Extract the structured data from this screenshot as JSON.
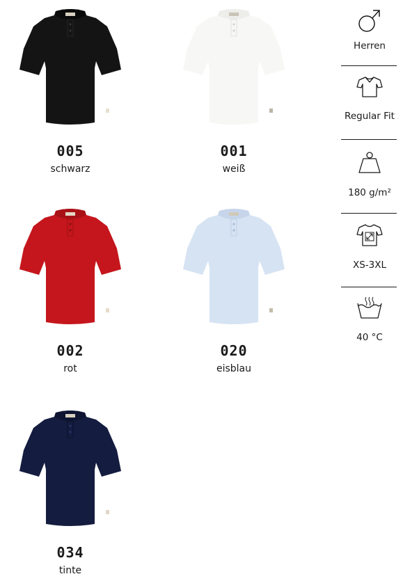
{
  "colors": {
    "black": "#141414",
    "white": "#f7f7f5",
    "red": "#c4161c",
    "iceblue": "#d6e3f3",
    "ink": "#141c3f"
  },
  "swatches": [
    {
      "code": "005",
      "name": "schwarz",
      "color": "#141414"
    },
    {
      "code": "001",
      "name": "weiß",
      "color": "#f7f7f5"
    },
    {
      "code": "002",
      "name": "rot",
      "color": "#c4161c"
    },
    {
      "code": "020",
      "name": "eisblau",
      "color": "#d6e3f3"
    },
    {
      "code": "034",
      "name": "tinte",
      "color": "#141c3f"
    }
  ],
  "features": [
    {
      "icon": "male-icon",
      "label": "Herren"
    },
    {
      "icon": "shirt-fit-icon",
      "label": "Regular Fit"
    },
    {
      "icon": "weight-icon",
      "label": "180 g/m²"
    },
    {
      "icon": "size-shirt-icon",
      "label": "XS-3XL"
    },
    {
      "icon": "wash-40-icon",
      "label": "40 °C"
    }
  ]
}
